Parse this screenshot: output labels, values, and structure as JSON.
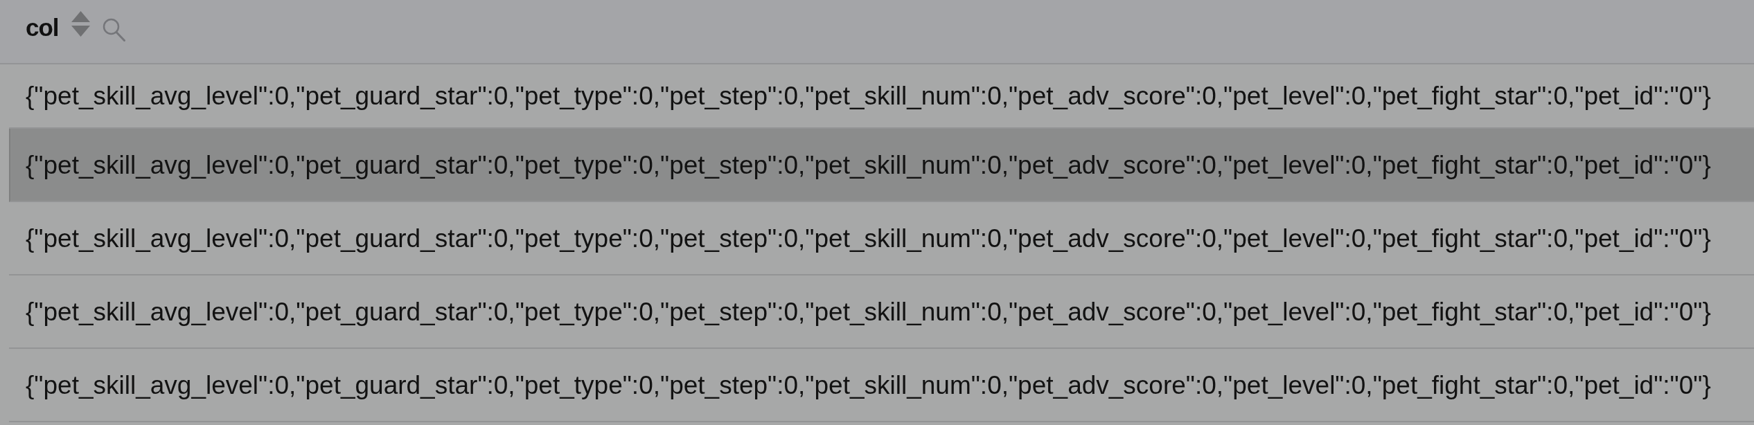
{
  "table": {
    "columns": [
      {
        "title": "col"
      }
    ],
    "rows": [
      {
        "cells": [
          "{\"pet_skill_avg_level\":0,\"pet_guard_star\":0,\"pet_type\":0,\"pet_step\":0,\"pet_skill_num\":0,\"pet_adv_score\":0,\"pet_level\":0,\"pet_fight_star\":0,\"pet_id\":\"0\"}"
        ],
        "highlighted": false
      },
      {
        "cells": [
          "{\"pet_skill_avg_level\":0,\"pet_guard_star\":0,\"pet_type\":0,\"pet_step\":0,\"pet_skill_num\":0,\"pet_adv_score\":0,\"pet_level\":0,\"pet_fight_star\":0,\"pet_id\":\"0\"}"
        ],
        "highlighted": true
      },
      {
        "cells": [
          "{\"pet_skill_avg_level\":0,\"pet_guard_star\":0,\"pet_type\":0,\"pet_step\":0,\"pet_skill_num\":0,\"pet_adv_score\":0,\"pet_level\":0,\"pet_fight_star\":0,\"pet_id\":\"0\"}"
        ],
        "highlighted": false
      },
      {
        "cells": [
          "{\"pet_skill_avg_level\":0,\"pet_guard_star\":0,\"pet_type\":0,\"pet_step\":0,\"pet_skill_num\":0,\"pet_adv_score\":0,\"pet_level\":0,\"pet_fight_star\":0,\"pet_id\":\"0\"}"
        ],
        "highlighted": false
      },
      {
        "cells": [
          "{\"pet_skill_avg_level\":0,\"pet_guard_star\":0,\"pet_type\":0,\"pet_step\":0,\"pet_skill_num\":0,\"pet_adv_score\":0,\"pet_level\":0,\"pet_fight_star\":0,\"pet_id\":\"0\"}"
        ],
        "highlighted": false
      }
    ]
  }
}
